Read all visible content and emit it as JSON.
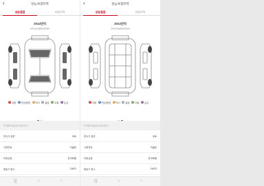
{
  "screens": [
    {
      "title": "성능/보험이력",
      "tabs": [
        "성능점검",
        "보험이력"
      ],
      "car_title": "2014년식",
      "vin": "VIN KNAM0000000",
      "legend": [
        {
          "label": "교환",
          "mark": "X",
          "color": "#e0323c"
        },
        {
          "label": "판금/용접",
          "mark": "W",
          "color": "#4f81c7"
        },
        {
          "label": "부식",
          "mark": "C",
          "color": "#e8a33c"
        },
        {
          "label": "흠집",
          "mark": "A",
          "color": "#9aa0a6"
        },
        {
          "label": "요철",
          "mark": "U",
          "color": "#7aa05a"
        },
        {
          "label": "손상",
          "mark": "T",
          "color": "#8d6ba8"
        }
      ],
      "info_notice": "위 차량의 성능점검 정보입니다",
      "rows": [
        {
          "key": "변속기 종류",
          "value": "오토"
        },
        {
          "key": "사용연료",
          "value": "가솔린"
        },
        {
          "key": "보증유형",
          "value": "자가보증"
        },
        {
          "key": "원동기 형식",
          "value": "G4FD"
        }
      ]
    },
    {
      "title": "성능/보험이력",
      "tabs": [
        "성능점검",
        "보험이력"
      ],
      "car_title": "2014년식",
      "vin": "VIN KNAM0000000",
      "legend": [
        {
          "label": "교환",
          "mark": "X",
          "color": "#e0323c"
        },
        {
          "label": "판금/용접",
          "mark": "W",
          "color": "#4f81c7"
        },
        {
          "label": "부식",
          "mark": "C",
          "color": "#e8a33c"
        },
        {
          "label": "흠집",
          "mark": "A",
          "color": "#9aa0a6"
        },
        {
          "label": "요철",
          "mark": "U",
          "color": "#7aa05a"
        },
        {
          "label": "손상",
          "mark": "T",
          "color": "#8d6ba8"
        }
      ],
      "info_notice": "위 차량의 성능점검 정보입니다",
      "rows": [
        {
          "key": "변속기 종류",
          "value": "오토"
        },
        {
          "key": "사용연료",
          "value": "가솔린"
        },
        {
          "key": "보증유형",
          "value": "자가보증"
        },
        {
          "key": "원동기 형식",
          "value": "G4FD"
        }
      ]
    }
  ],
  "accent_color": "#c40018"
}
